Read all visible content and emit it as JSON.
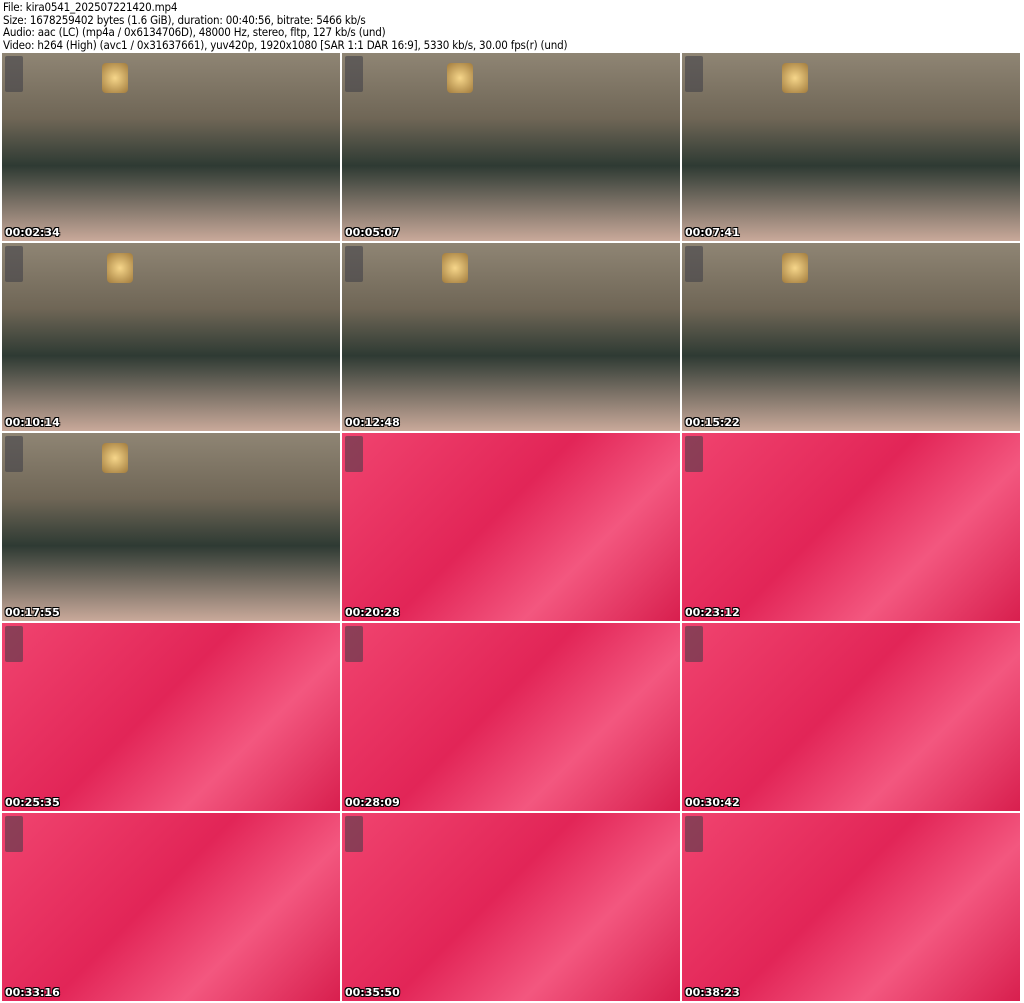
{
  "header": {
    "file": "File: kira0541_202507221420.mp4",
    "size": "Size: 1678259402 bytes (1.6 GiB), duration: 00:40:56, bitrate: 5466 kb/s",
    "audio": "Audio: aac (LC) (mp4a / 0x6134706D), 48000 Hz, stereo, fltp, 127 kb/s (und)",
    "video": "Video: h264 (High) (avc1 / 0x31637661), yuv420p, 1920x1080 [SAR 1:1 DAR 16:9], 5330 kb/s, 30.00 fps(r) (und)"
  },
  "thumbnails": [
    {
      "time": "00:02:34",
      "scene": "room"
    },
    {
      "time": "00:05:07",
      "scene": "room"
    },
    {
      "time": "00:07:41",
      "scene": "room"
    },
    {
      "time": "00:10:14",
      "scene": "room"
    },
    {
      "time": "00:12:48",
      "scene": "room"
    },
    {
      "time": "00:15:22",
      "scene": "room"
    },
    {
      "time": "00:17:55",
      "scene": "room"
    },
    {
      "time": "00:20:28",
      "scene": "pink"
    },
    {
      "time": "00:23:12",
      "scene": "pink"
    },
    {
      "time": "00:25:35",
      "scene": "pink"
    },
    {
      "time": "00:28:09",
      "scene": "pink"
    },
    {
      "time": "00:30:42",
      "scene": "pink"
    },
    {
      "time": "00:33:16",
      "scene": "pink"
    },
    {
      "time": "00:35:50",
      "scene": "pink"
    },
    {
      "time": "00:38:23",
      "scene": "pink"
    }
  ]
}
